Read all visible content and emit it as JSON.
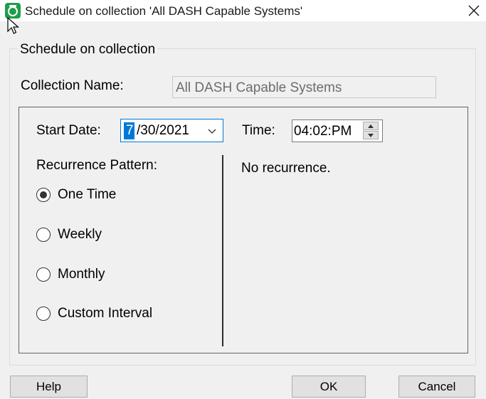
{
  "window": {
    "title": "Schedule on collection 'All DASH Capable Systems'",
    "icons": {
      "app": "app-icon",
      "close": "close-icon"
    }
  },
  "group": {
    "label": "Schedule on collection"
  },
  "collection": {
    "label": "Collection Name:",
    "value": "All DASH Capable Systems"
  },
  "start_date": {
    "label": "Start Date:",
    "selected_part": "7",
    "rest": "/30/2021"
  },
  "time": {
    "label": "Time:",
    "value": "04:02:PM"
  },
  "recurrence": {
    "label": "Recurrence Pattern:",
    "options": [
      {
        "label": "One Time",
        "checked": true
      },
      {
        "label": "Weekly",
        "checked": false
      },
      {
        "label": "Monthly",
        "checked": false
      },
      {
        "label": "Custom Interval",
        "checked": false
      }
    ],
    "summary": "No recurrence."
  },
  "buttons": {
    "help": "Help",
    "ok": "OK",
    "cancel": "Cancel"
  },
  "colors": {
    "accent": "#0078d7",
    "app_icon": "#1e9e4a",
    "dialog_bg": "#f0f0f0"
  }
}
